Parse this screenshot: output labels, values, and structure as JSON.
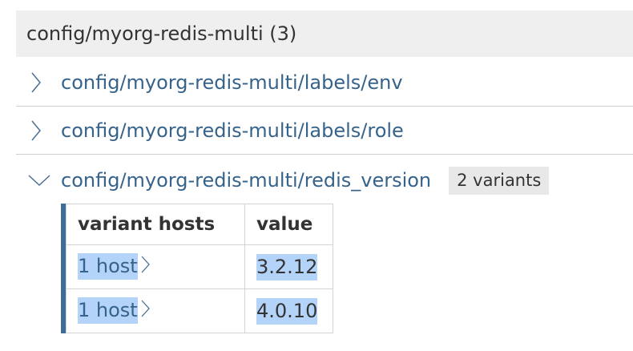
{
  "group": {
    "title": "config/myorg-redis-multi (3)"
  },
  "rows": [
    {
      "label": "config/myorg-redis-multi/labels/env",
      "expanded": false,
      "icon": "chevron-right-icon"
    },
    {
      "label": "config/myorg-redis-multi/labels/role",
      "expanded": false,
      "icon": "chevron-right-icon"
    },
    {
      "label": "config/myorg-redis-multi/redis_version",
      "expanded": true,
      "icon": "chevron-down-icon",
      "badge": "2 variants"
    }
  ],
  "variants_table": {
    "headers": [
      "variant hosts",
      "value"
    ],
    "rows": [
      {
        "hosts": "1 host",
        "value": "3.2.12"
      },
      {
        "hosts": "1 host",
        "value": "4.0.10"
      }
    ]
  },
  "colors": {
    "link": "#36638b",
    "accent_bar": "#3e6e96",
    "selection": "#b4d3f8",
    "header_bg": "#efefef",
    "badge_bg": "#e8e8e8"
  }
}
